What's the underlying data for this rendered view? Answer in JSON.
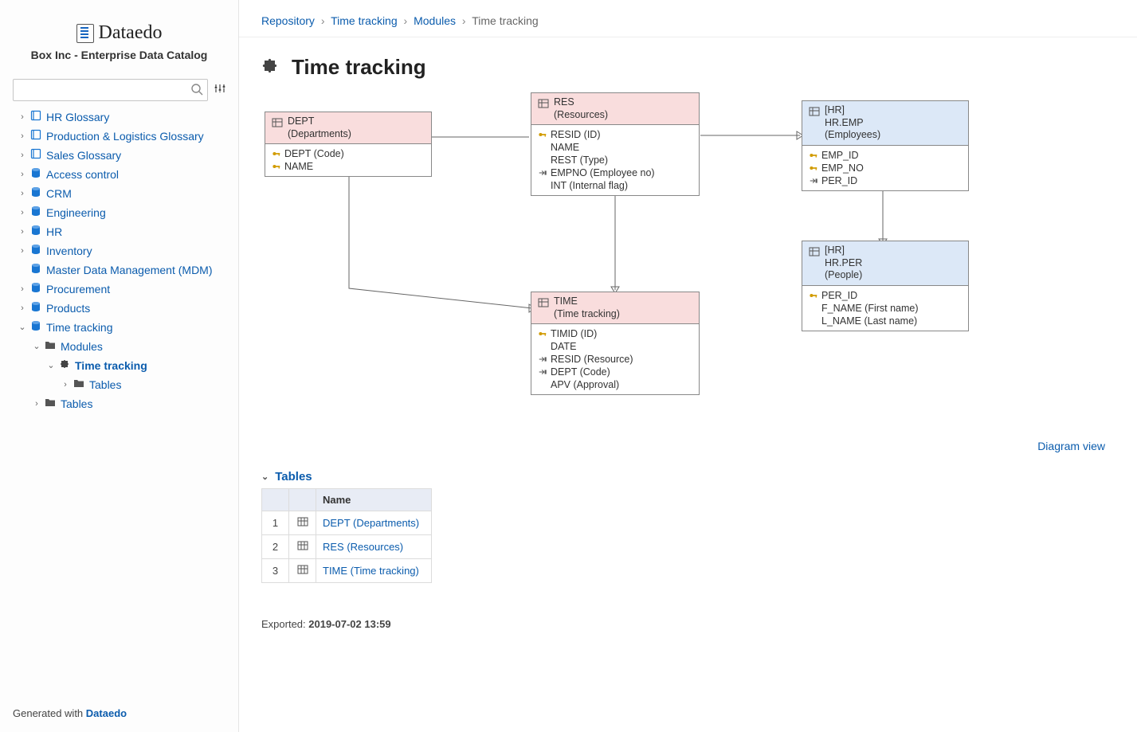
{
  "app": {
    "brand": "Dataedo",
    "subtitle": "Box Inc - Enterprise Data Catalog",
    "footer_prefix": "Generated with ",
    "footer_brand": "Dataedo"
  },
  "search": {
    "placeholder": ""
  },
  "sidebar": {
    "items": [
      {
        "type": "book",
        "label": "HR Glossary",
        "expander": "›"
      },
      {
        "type": "book",
        "label": "Production & Logistics Glossary",
        "expander": "›"
      },
      {
        "type": "book",
        "label": "Sales Glossary",
        "expander": "›"
      },
      {
        "type": "db",
        "label": "Access control",
        "expander": "›"
      },
      {
        "type": "db",
        "label": "CRM",
        "expander": "›"
      },
      {
        "type": "db",
        "label": "Engineering",
        "expander": "›"
      },
      {
        "type": "db",
        "label": "HR",
        "expander": "›"
      },
      {
        "type": "db",
        "label": "Inventory",
        "expander": "›"
      },
      {
        "type": "db",
        "label": "Master Data Management (MDM)",
        "expander": ""
      },
      {
        "type": "db",
        "label": "Procurement",
        "expander": "›"
      },
      {
        "type": "db",
        "label": "Products",
        "expander": "›"
      },
      {
        "type": "db",
        "label": "Time tracking",
        "expander": "⌄"
      }
    ],
    "tt_children": {
      "modules_label": "Modules",
      "time_tracking_label": "Time tracking",
      "tables_inner_label": "Tables",
      "tables_outer_label": "Tables"
    }
  },
  "breadcrumb": {
    "c1": "Repository",
    "c2": "Time tracking",
    "c3": "Modules",
    "cur": "Time tracking",
    "sep": "›"
  },
  "page": {
    "title": "Time tracking"
  },
  "diagram_link": "Diagram view",
  "entities": {
    "dept": {
      "title1": "DEPT",
      "title2": "(Departments)",
      "cols": [
        {
          "ico": "key",
          "txt": "DEPT (Code)"
        },
        {
          "ico": "key",
          "txt": "NAME"
        }
      ]
    },
    "res": {
      "title1": "RES",
      "title2": "(Resources)",
      "cols": [
        {
          "ico": "key",
          "txt": "RESID (ID)"
        },
        {
          "ico": "",
          "txt": "NAME"
        },
        {
          "ico": "",
          "txt": "REST (Type)"
        },
        {
          "ico": "fk",
          "txt": "EMPNO (Employee no)"
        },
        {
          "ico": "",
          "txt": "INT (Internal flag)"
        }
      ]
    },
    "time": {
      "title1": "TIME",
      "title2": "(Time tracking)",
      "cols": [
        {
          "ico": "key",
          "txt": "TIMID (ID)"
        },
        {
          "ico": "",
          "txt": "DATE"
        },
        {
          "ico": "fk",
          "txt": "RESID (Resource)"
        },
        {
          "ico": "fk",
          "txt": "DEPT (Code)"
        },
        {
          "ico": "",
          "txt": "APV (Approval)"
        }
      ]
    },
    "hremp": {
      "schema": "[HR]",
      "title1": "HR.EMP",
      "title2": "(Employees)",
      "cols": [
        {
          "ico": "key",
          "txt": "EMP_ID"
        },
        {
          "ico": "key",
          "txt": "EMP_NO"
        },
        {
          "ico": "fk",
          "txt": "PER_ID"
        }
      ]
    },
    "hrper": {
      "schema": "[HR]",
      "title1": "HR.PER",
      "title2": "(People)",
      "cols": [
        {
          "ico": "key",
          "txt": "PER_ID"
        },
        {
          "ico": "",
          "txt": "F_NAME (First name)"
        },
        {
          "ico": "",
          "txt": "L_NAME (Last name)"
        }
      ]
    }
  },
  "tables_section": {
    "heading": "Tables",
    "name_header": "Name",
    "rows": [
      {
        "n": "1",
        "label": "DEPT (Departments)"
      },
      {
        "n": "2",
        "label": "RES (Resources)"
      },
      {
        "n": "3",
        "label": "TIME (Time tracking)"
      }
    ]
  },
  "exported": {
    "prefix": "Exported: ",
    "stamp": "2019-07-02 13:59"
  }
}
